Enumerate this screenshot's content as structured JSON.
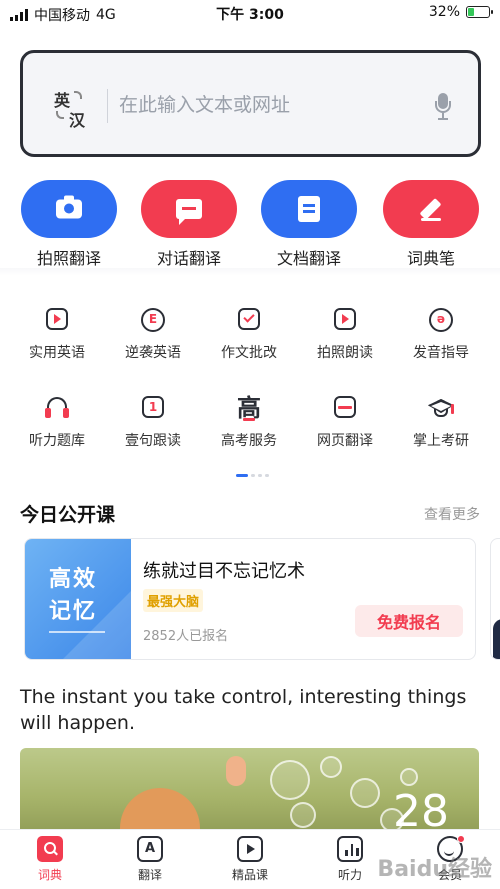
{
  "status_bar": {
    "carrier": "中国移动",
    "network": "4G",
    "time": "下午 3:00",
    "battery_percent": "32%",
    "battery_level": 0.32
  },
  "search": {
    "lang_from": "英",
    "lang_to": "汉",
    "placeholder": "在此输入文本或网址",
    "value": ""
  },
  "features": [
    {
      "label": "拍照翻译",
      "icon": "camera-icon",
      "color": "#2f6ef2"
    },
    {
      "label": "对话翻译",
      "icon": "chat-icon",
      "color": "#f23c50"
    },
    {
      "label": "文档翻译",
      "icon": "document-icon",
      "color": "#2f6ef2"
    },
    {
      "label": "词典笔",
      "icon": "pen-icon",
      "color": "#f23c50"
    }
  ],
  "tools": [
    {
      "label": "实用英语",
      "icon": "play-card-icon"
    },
    {
      "label": "逆袭英语",
      "icon": "e-bubble-icon"
    },
    {
      "label": "作文批改",
      "icon": "check-clipboard-icon"
    },
    {
      "label": "拍照朗读",
      "icon": "camera-play-icon"
    },
    {
      "label": "发音指导",
      "icon": "pronunciation-icon"
    },
    {
      "label": "听力题库",
      "icon": "headphones-icon"
    },
    {
      "label": "壹句跟读",
      "icon": "calendar-one-icon"
    },
    {
      "label": "高考服务",
      "icon": "gaokao-icon"
    },
    {
      "label": "网页翻译",
      "icon": "webpage-icon"
    },
    {
      "label": "掌上考研",
      "icon": "graduation-cap-icon"
    }
  ],
  "today_course": {
    "section_title": "今日公开课",
    "more_label": "查看更多",
    "thumb_line1": "高效",
    "thumb_line2": "记忆",
    "title": "练就过目不忘记忆术",
    "tag": "最强大脑",
    "enrolled": "2852人已报名",
    "button_label": "免费报名"
  },
  "daily_quote": {
    "text": "The instant you take control, interesting things will happen.",
    "day": "28"
  },
  "tabbar": {
    "items": [
      {
        "label": "词典",
        "icon": "dictionary-icon",
        "active": true
      },
      {
        "label": "翻译",
        "icon": "translate-icon",
        "active": false
      },
      {
        "label": "精品课",
        "icon": "course-icon",
        "active": false
      },
      {
        "label": "听力",
        "icon": "listening-icon",
        "active": false
      },
      {
        "label": "会员",
        "icon": "member-icon",
        "active": false
      }
    ]
  },
  "watermark": "Baidu经验",
  "colors": {
    "brand_red": "#f23c50",
    "brand_blue": "#2f6ef2",
    "text_dark": "#222222",
    "text_muted": "#999999"
  }
}
